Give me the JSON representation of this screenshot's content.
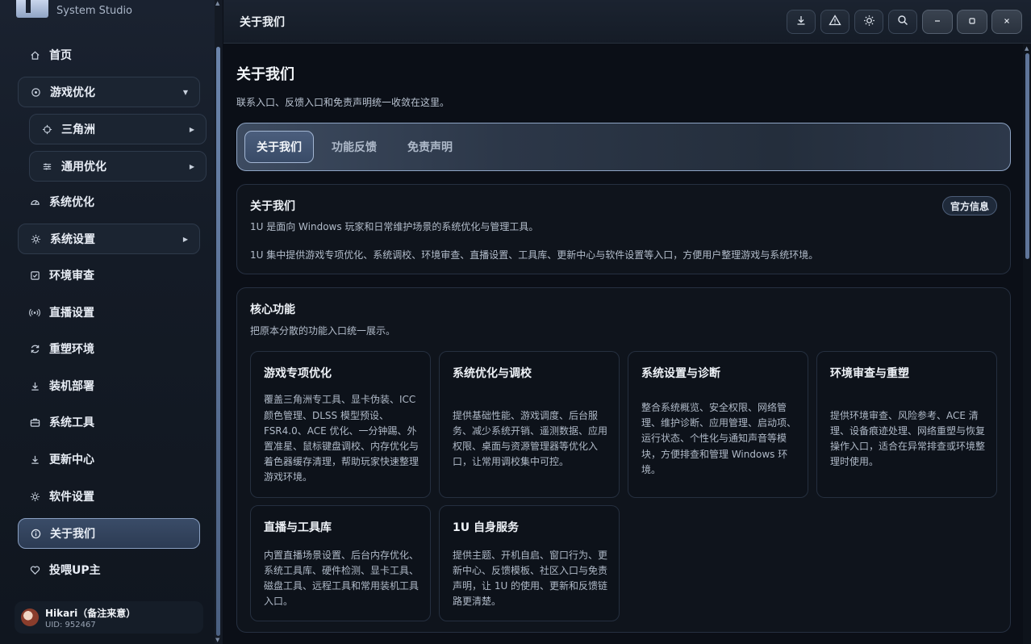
{
  "app": {
    "subtitle": "System Studio"
  },
  "sidebar": {
    "items": [
      {
        "label": "首页",
        "icon": "home-icon"
      },
      {
        "label": "游戏优化",
        "icon": "target-icon"
      },
      {
        "label": "三角洲",
        "icon": "crosshair-icon"
      },
      {
        "label": "通用优化",
        "icon": "sliders-icon"
      },
      {
        "label": "系统优化",
        "icon": "gauge-icon"
      },
      {
        "label": "系统设置",
        "icon": "gear-icon"
      },
      {
        "label": "环境审查",
        "icon": "checkbox-icon"
      },
      {
        "label": "直播设置",
        "icon": "broadcast-icon"
      },
      {
        "label": "重塑环境",
        "icon": "refresh-icon"
      },
      {
        "label": "装机部署",
        "icon": "download-icon"
      },
      {
        "label": "系统工具",
        "icon": "toolbox-icon"
      },
      {
        "label": "更新中心",
        "icon": "download-icon"
      },
      {
        "label": "软件设置",
        "icon": "gear-icon"
      },
      {
        "label": "关于我们",
        "icon": "info-icon"
      },
      {
        "label": "投喂UP主",
        "icon": "heart-icon"
      }
    ],
    "user": {
      "name": "Hikari（备注来意）",
      "uid": "UID: 952467"
    }
  },
  "titlebar": {
    "title": "关于我们"
  },
  "page": {
    "title": "关于我们",
    "description": "联系入口、反馈入口和免责声明统一收敛在这里。"
  },
  "tabs": [
    {
      "label": "关于我们"
    },
    {
      "label": "功能反馈"
    },
    {
      "label": "免责声明"
    }
  ],
  "about": {
    "title": "关于我们",
    "badge": "官方信息",
    "line1": "1U 是面向 Windows 玩家和日常维护场景的系统优化与管理工具。",
    "line2": "1U 集中提供游戏专项优化、系统调校、环境审查、直播设置、工具库、更新中心与软件设置等入口，方便用户整理游戏与系统环境。"
  },
  "core": {
    "title": "核心功能",
    "subtitle": "把原本分散的功能入口统一展示。",
    "features": [
      {
        "title": "游戏专项优化",
        "desc": "覆盖三角洲专工具、显卡伪装、ICC 颜色管理、DLSS 模型预设、FSR4.0、ACE 优化、一分钟踢、外置准星、鼠标键盘调校、内存优化与着色器缓存清理，帮助玩家快速整理游戏环境。"
      },
      {
        "title": "系统优化与调校",
        "desc": "提供基础性能、游戏调度、后台服务、减少系统开销、遥测数据、应用权限、桌面与资源管理器等优化入口，让常用调校集中可控。"
      },
      {
        "title": "系统设置与诊断",
        "desc": "整合系统概览、安全权限、网络管理、维护诊断、应用管理、启动项、运行状态、个性化与通知声音等模块，方便排查和管理 Windows 环境。"
      },
      {
        "title": "环境审查与重塑",
        "desc": "提供环境审查、风险参考、ACE 清理、设备痕迹处理、网络重塑与恢复操作入口，适合在异常排查或环境整理时使用。"
      },
      {
        "title": "直播与工具库",
        "desc": "内置直播场景设置、后台内存优化、系统工具库、硬件检测、显卡工具、磁盘工具、远程工具和常用装机工具入口。"
      },
      {
        "title": "1U 自身服务",
        "desc": "提供主题、开机自启、窗口行为、更新中心、反馈模板、社区入口与免责声明，让 1U 的使用、更新和反馈链路更清楚。"
      }
    ]
  }
}
